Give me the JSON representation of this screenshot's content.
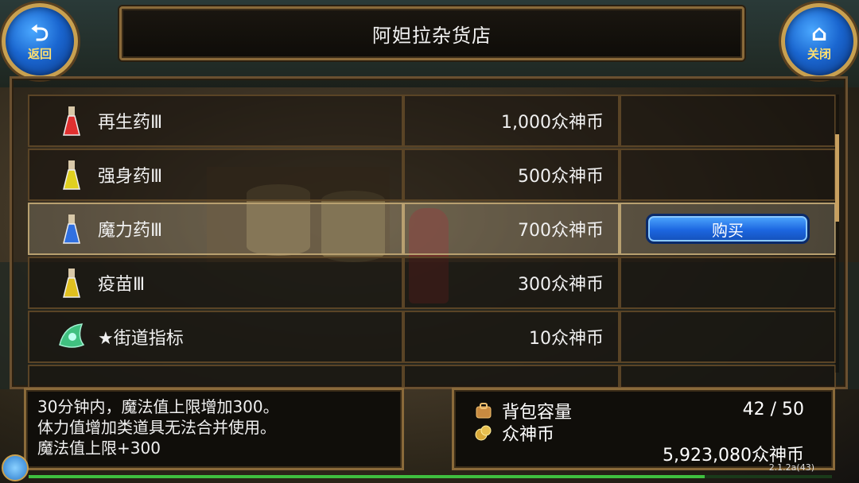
{
  "header": {
    "title": "阿妲拉杂货店"
  },
  "back_button": {
    "label": "返回",
    "icon": "back-arrow-icon"
  },
  "close_button": {
    "label": "关闭",
    "icon": "home-icon"
  },
  "items": [
    {
      "name": "再生药Ⅲ",
      "price": "1,000众神币",
      "icon": "red-potion-icon",
      "potion_color": "#e03030"
    },
    {
      "name": "强身药Ⅲ",
      "price": "500众神币",
      "icon": "yellow-potion-icon",
      "potion_color": "#e0d020"
    },
    {
      "name": "魔力药Ⅲ",
      "price": "700众神币",
      "icon": "blue-potion-icon",
      "potion_color": "#3070e0",
      "selected": true
    },
    {
      "name": "疫苗Ⅲ",
      "price": "300众神币",
      "icon": "yellow-potion-icon",
      "potion_color": "#e0c020"
    },
    {
      "name": "★街道指标",
      "price": "10众神币",
      "icon": "green-scroll-icon",
      "potion_color": "#40c080"
    }
  ],
  "buy_button": {
    "label": "购买"
  },
  "description": {
    "lines": [
      "30分钟内，魔法值上限增加300。",
      "体力值增加类道具无法合并使用。",
      "魔法值上限+300"
    ]
  },
  "inventory": {
    "capacity_label": "背包容量",
    "capacity_value": "42 / 50",
    "currency_label": "众神币",
    "currency_value": "5,923,080众神币"
  },
  "version": "2.1.2a(43)",
  "colors": {
    "accent_gold": "#c8a050",
    "button_blue": "#1c66e0",
    "exp_bar": "#3fbf3f"
  }
}
